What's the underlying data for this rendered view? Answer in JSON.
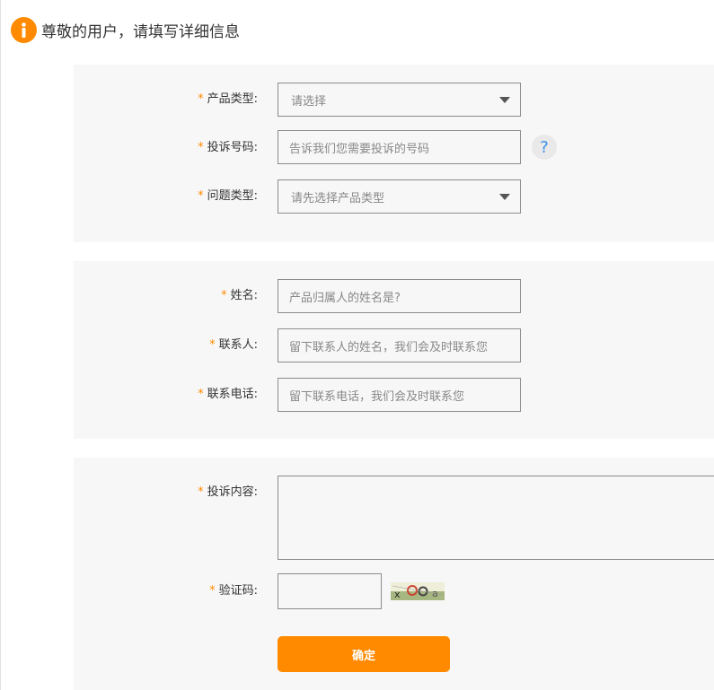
{
  "header": {
    "title": "尊敬的用户，请填写详细信息"
  },
  "form": {
    "product_type": {
      "label": "产品类型:",
      "value": "请选择"
    },
    "complaint_number": {
      "label": "投诉号码:",
      "placeholder": "告诉我们您需要投诉的号码",
      "help": "?"
    },
    "issue_type": {
      "label": "问题类型:",
      "value": "请先选择产品类型"
    },
    "name": {
      "label": "姓名:",
      "placeholder": "产品归属人的姓名是?"
    },
    "contact": {
      "label": "联系人:",
      "placeholder": "留下联系人的姓名，我们会及时联系您"
    },
    "phone": {
      "label": "联系电话:",
      "placeholder": "留下联系电话，我们会及时联系您"
    },
    "content": {
      "label": "投诉内容:"
    },
    "captcha": {
      "label": "验证码:"
    },
    "submit_label": "确定",
    "required_mark": "*"
  }
}
